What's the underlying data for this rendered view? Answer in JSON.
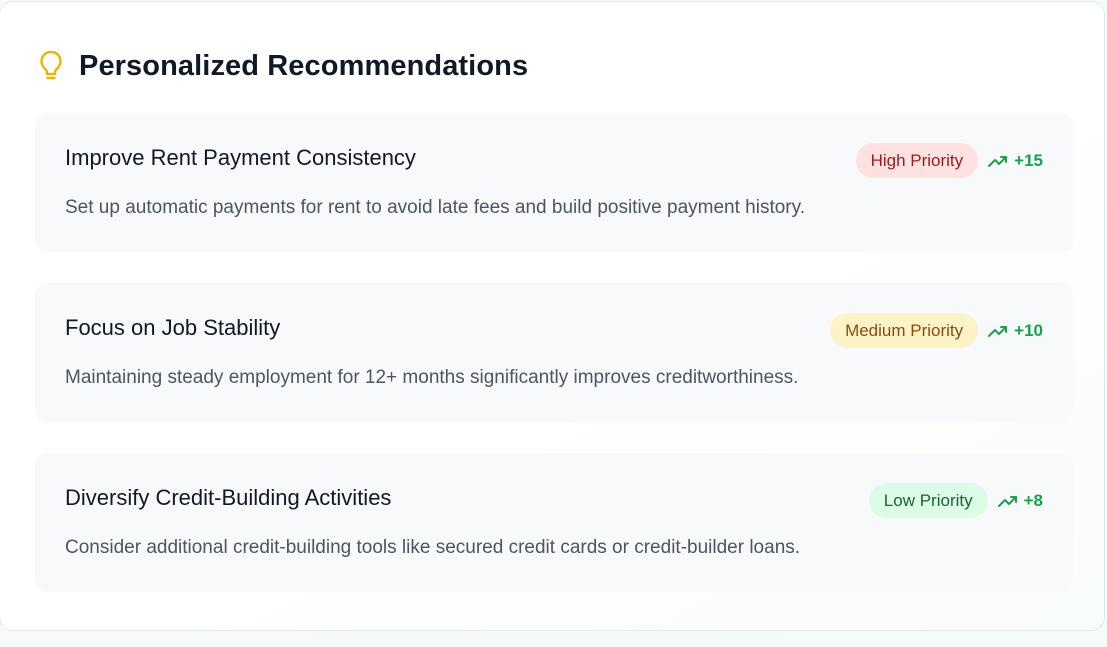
{
  "header": {
    "icon": "lightbulb-icon",
    "title": "Personalized Recommendations"
  },
  "colors": {
    "bulb": "#eab308",
    "impact": "#16a34a"
  },
  "recommendations": [
    {
      "title": "Improve Rent Payment Consistency",
      "description": "Set up automatic payments for rent to avoid late fees and build positive payment history.",
      "priority": "High Priority",
      "impact": "+15",
      "impact_icon": "trending-up-icon",
      "badge_bg": "#fee2e2",
      "badge_fg": "#991b1b"
    },
    {
      "title": "Focus on Job Stability",
      "description": "Maintaining steady employment for 12+ months significantly improves creditworthiness.",
      "priority": "Medium Priority",
      "impact": "+10",
      "impact_icon": "trending-up-icon",
      "badge_bg": "#fef3c7",
      "badge_fg": "#854d0e"
    },
    {
      "title": "Diversify Credit-Building Activities",
      "description": "Consider additional credit-building tools like secured credit cards or credit-builder loans.",
      "priority": "Low Priority",
      "impact": "+8",
      "impact_icon": "trending-up-icon",
      "badge_bg": "#dcfce7",
      "badge_fg": "#166534"
    }
  ]
}
